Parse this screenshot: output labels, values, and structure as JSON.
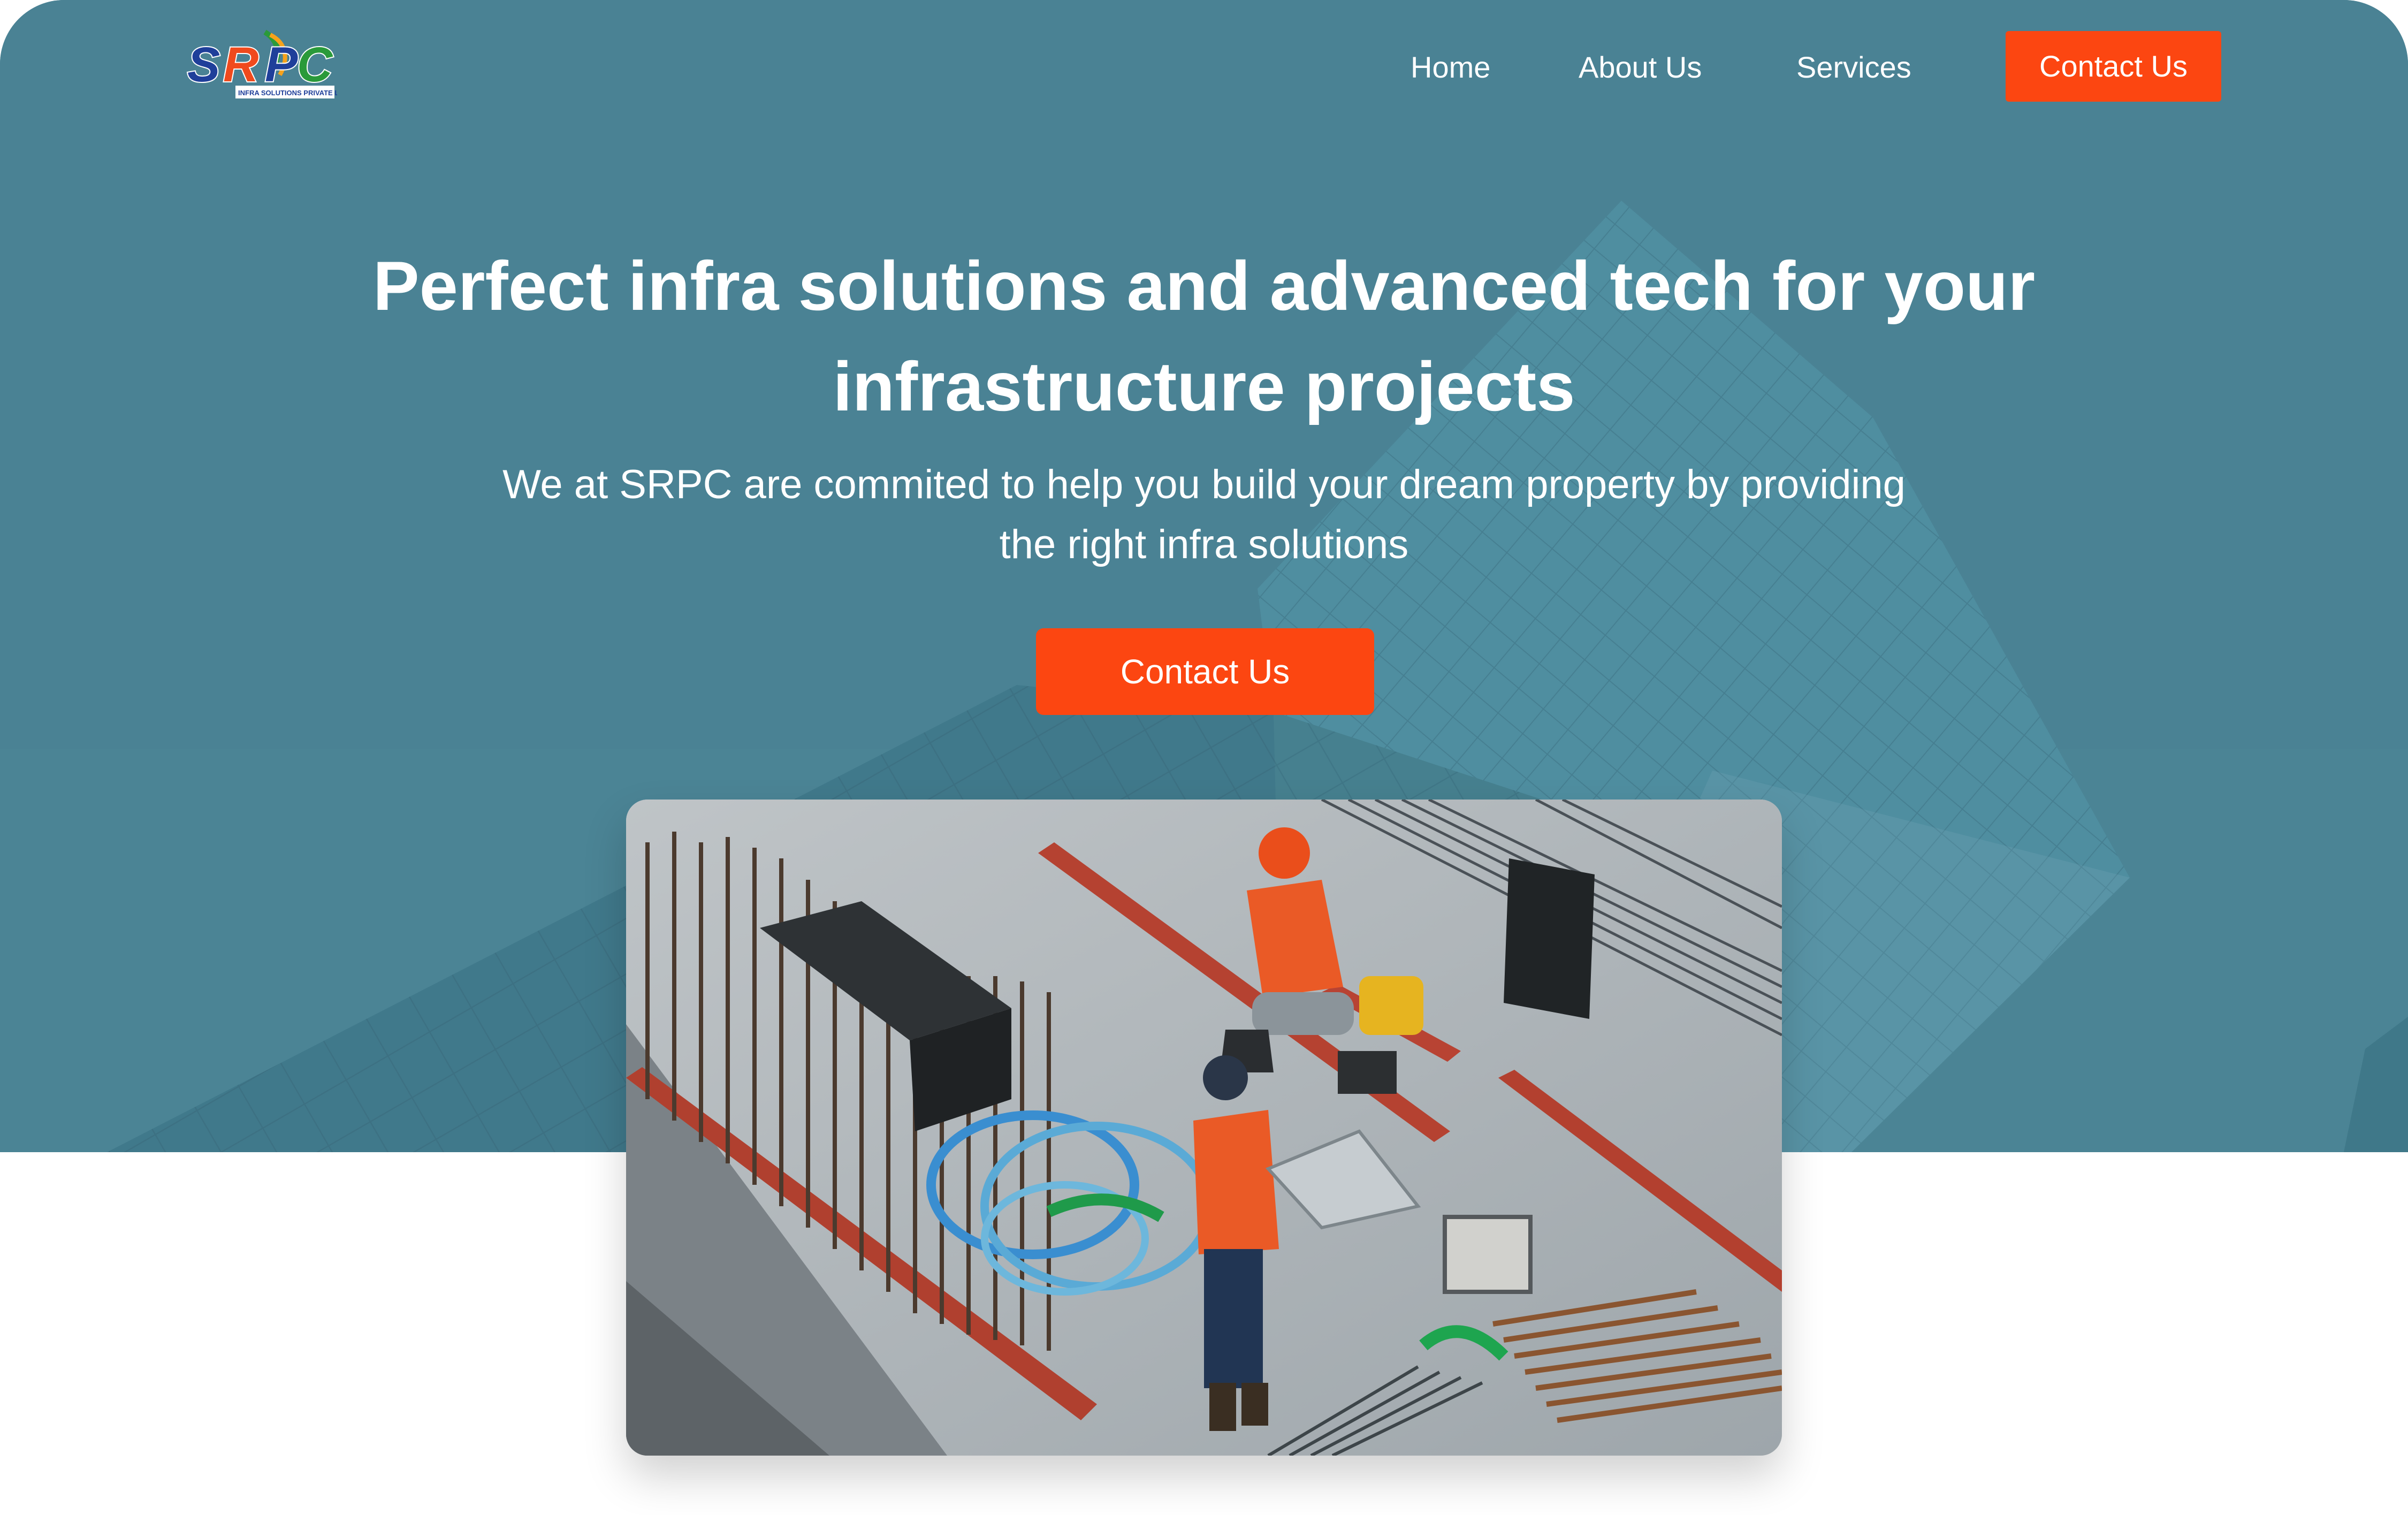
{
  "brand": {
    "logo_text": "SRPC",
    "logo_tagline": "INFRA SOLUTIONS PRIVATE LIMITED"
  },
  "nav": {
    "items": [
      {
        "label": "Home"
      },
      {
        "label": "About Us"
      },
      {
        "label": "Services"
      }
    ],
    "cta_label": "Contact Us"
  },
  "hero": {
    "headline_line1": "Perfect infra solutions and advanced tech for your",
    "headline_line2": "infrastructure projects",
    "subtext_line1": "We at SRPC are commited to help you build your dream property by providing",
    "subtext_line2": "the right infra solutions",
    "cta_label": "Contact Us"
  },
  "colors": {
    "accent": "#fc4611",
    "hero_overlay": "#477f91",
    "text_on_hero": "#ffffff"
  }
}
